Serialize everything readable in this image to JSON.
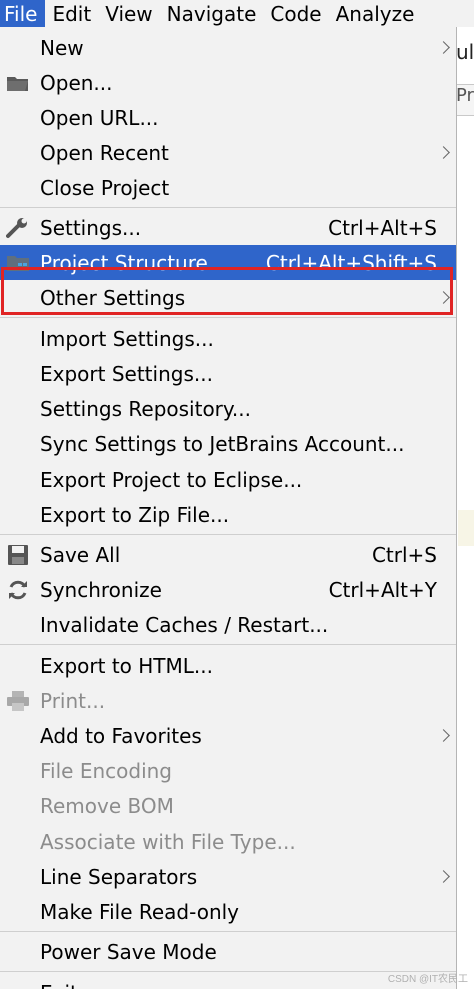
{
  "menubar": {
    "items": [
      "File",
      "Edit",
      "View",
      "Navigate",
      "Code",
      "Analyze"
    ]
  },
  "editor": {
    "tab_fragment": "ula",
    "tab2_fragment": "Pr"
  },
  "menu": {
    "items": [
      {
        "label": "New",
        "submenu": true
      },
      {
        "label": "Open...",
        "icon": "folder-icon"
      },
      {
        "label": "Open URL..."
      },
      {
        "label": "Open Recent",
        "submenu": true
      },
      {
        "label": "Close Project"
      },
      {
        "label": "Settings...",
        "shortcut": "Ctrl+Alt+S",
        "icon": "wrench-icon"
      },
      {
        "label": "Project Structure...",
        "shortcut": "Ctrl+Alt+Shift+S",
        "icon": "project-structure-icon",
        "selected": true
      },
      {
        "label": "Other Settings",
        "submenu": true
      },
      {
        "label": "Import Settings..."
      },
      {
        "label": "Export Settings..."
      },
      {
        "label": "Settings Repository..."
      },
      {
        "label": "Sync Settings to JetBrains Account..."
      },
      {
        "label": "Export Project to Eclipse..."
      },
      {
        "label": "Export to Zip File..."
      },
      {
        "label": "Save All",
        "shortcut": "Ctrl+S",
        "icon": "save-icon"
      },
      {
        "label": "Synchronize",
        "shortcut": "Ctrl+Alt+Y",
        "icon": "sync-icon"
      },
      {
        "label": "Invalidate Caches / Restart..."
      },
      {
        "label": "Export to HTML..."
      },
      {
        "label": "Print...",
        "icon": "printer-icon",
        "disabled": true
      },
      {
        "label": "Add to Favorites",
        "submenu": true
      },
      {
        "label": "File Encoding",
        "disabled": true
      },
      {
        "label": "Remove BOM",
        "disabled": true
      },
      {
        "label": "Associate with File Type...",
        "disabled": true
      },
      {
        "label": "Line Separators",
        "submenu": true
      },
      {
        "label": "Make File Read-only"
      },
      {
        "label": "Power Save Mode"
      },
      {
        "label": "Exit"
      }
    ]
  },
  "colors": {
    "selection": "#2f65ca",
    "highlight_box": "#e02424",
    "menu_bg": "#f2f2f2"
  },
  "watermark": "CSDN @IT农民工"
}
